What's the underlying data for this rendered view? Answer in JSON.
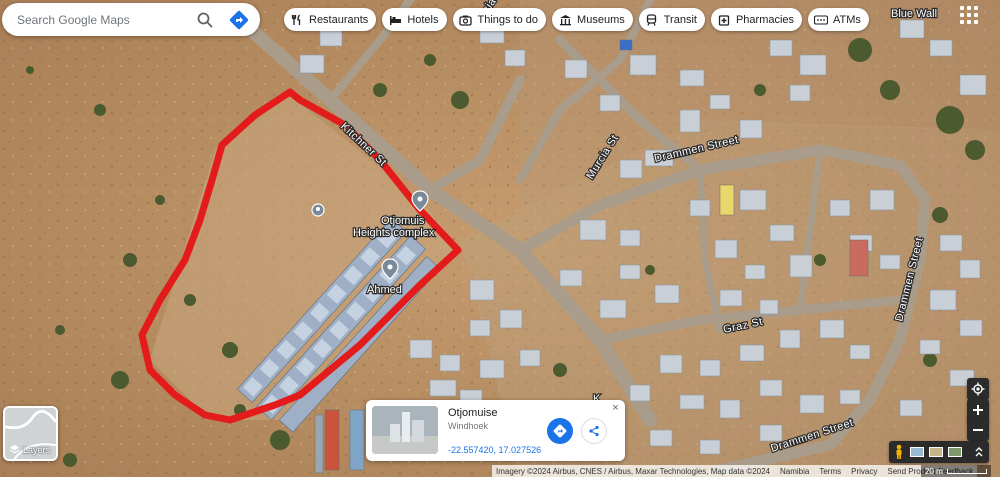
{
  "search": {
    "placeholder": "Search Google Maps"
  },
  "chips": [
    {
      "label": "Restaurants",
      "icon": "utensils-icon"
    },
    {
      "label": "Hotels",
      "icon": "bed-icon"
    },
    {
      "label": "Things to do",
      "icon": "camera-icon"
    },
    {
      "label": "Museums",
      "icon": "museum-icon"
    },
    {
      "label": "Transit",
      "icon": "train-icon"
    },
    {
      "label": "Pharmacies",
      "icon": "pharmacy-icon"
    },
    {
      "label": "ATMs",
      "icon": "atm-icon"
    }
  ],
  "map_labels": {
    "blue_wall": "Blue Wall",
    "kitchner_st": "Kitchner St",
    "murcia_st_top": "Murcia St",
    "murcia_st": "Murcia St",
    "drammen_street_top": "Drammen Street",
    "drammen_street_right": "Drammen Street",
    "drammen_street_bottom": "Drammen Street",
    "graz_st": "Graz St",
    "otjomuise_complex_line1": "Otjomuis",
    "otjomuise_complex_line2": "Heights complex",
    "ahmed": "Ahmed",
    "k_fragment": "K"
  },
  "layers": {
    "label": "Layers"
  },
  "place_card": {
    "title": "Otjomuise",
    "subtitle": "Windhoek",
    "coordinates": "-22.557420, 17.027526",
    "close": "×"
  },
  "attribution": {
    "imagery": "Imagery ©2024 Airbus, CNES / Airbus, Maxar Technologies, Map data ©2024",
    "country": "Namibia",
    "terms": "Terms",
    "privacy": "Privacy",
    "feedback": "Send Product Feedback",
    "scale": "20 m"
  },
  "colors": {
    "highlight_outline": "#e31b1b",
    "accent_blue": "#1a73e8",
    "ground": "#b58a60",
    "road": "#a99c8a"
  }
}
